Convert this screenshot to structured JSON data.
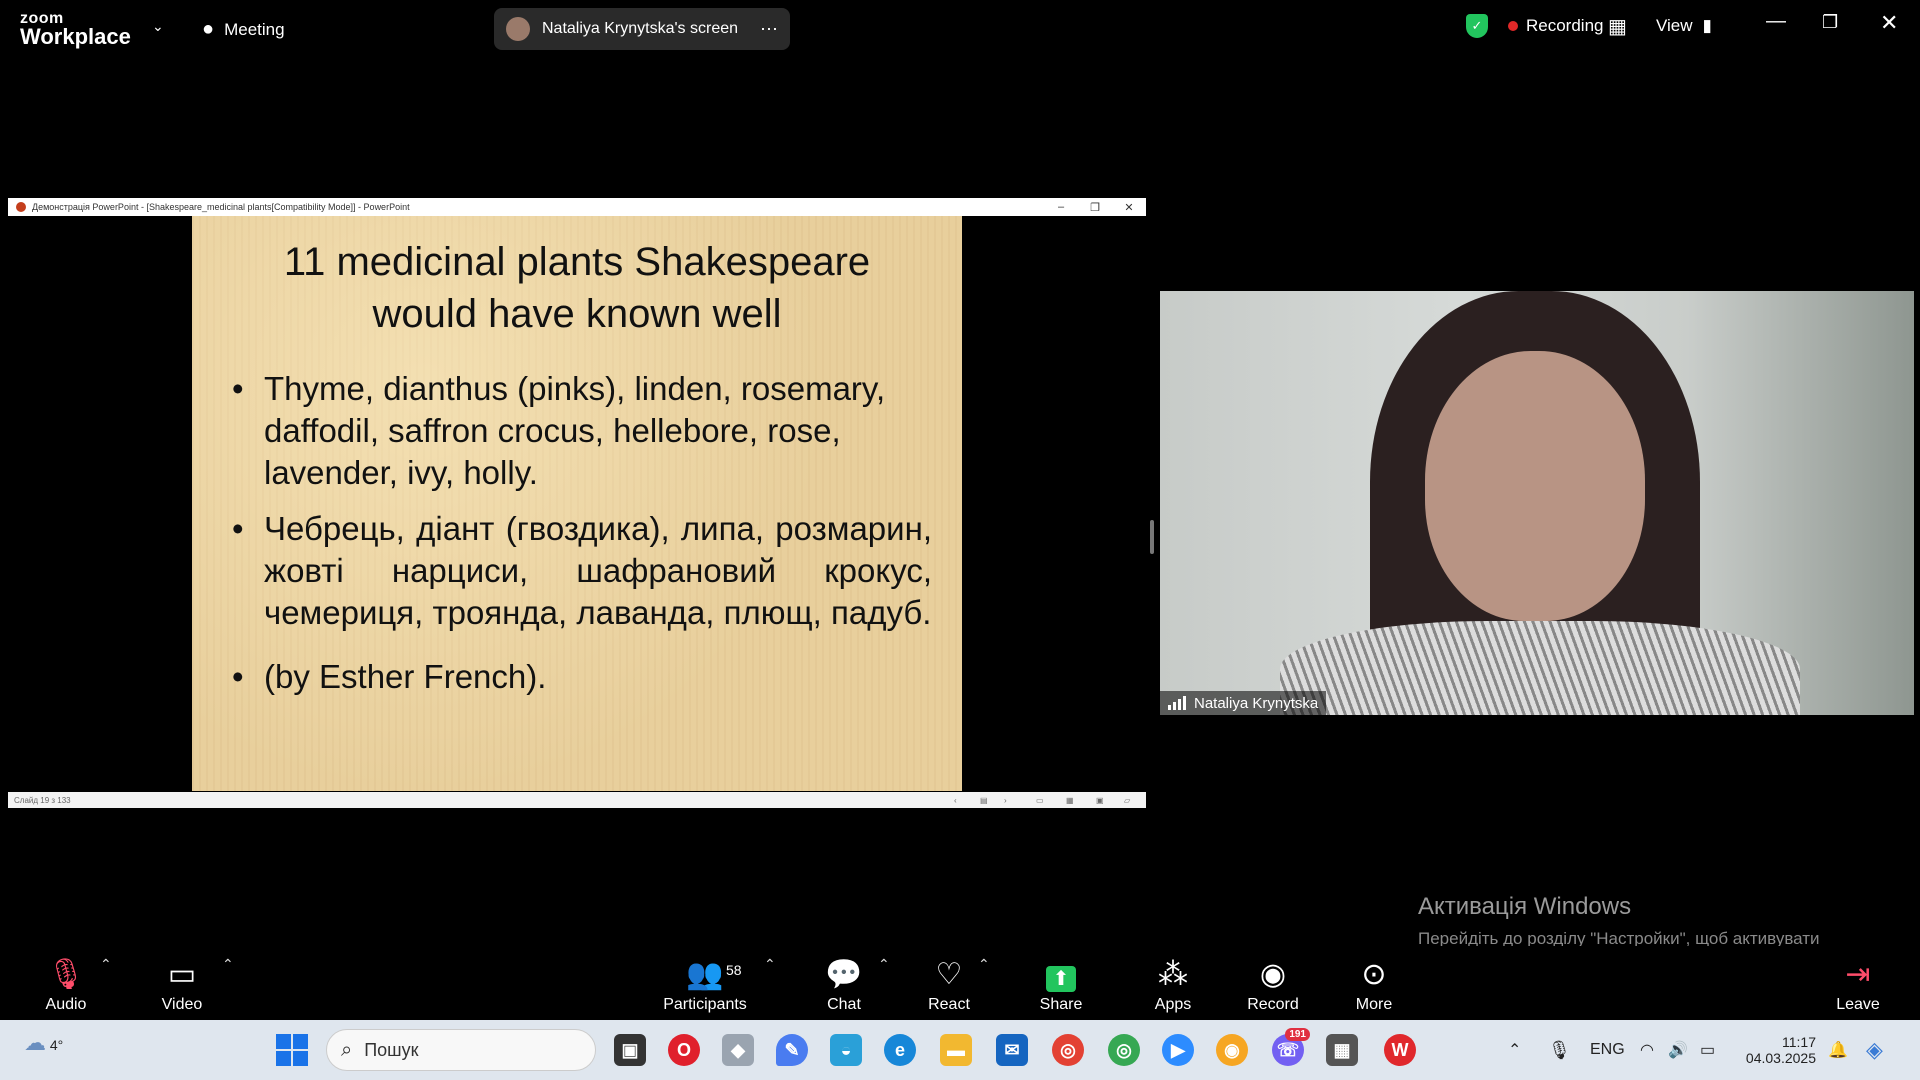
{
  "topbar": {
    "logo_small": "zoom",
    "logo_big": "Workplace",
    "meeting_label": "Meeting",
    "share_label": "Nataliya Krynytska's screen",
    "recording_label": "Recording",
    "view_label": "View",
    "colors": {
      "recording": "#e02828",
      "shield": "#22c55e"
    }
  },
  "ppt": {
    "window_title": "Демонстрація PowerPoint - [Shakespeare_medicinal plants[Compatibility Mode]] - PowerPoint",
    "status": "Слайд 19 з 133"
  },
  "slide": {
    "title_line1": "11 medicinal plants Shakespeare",
    "title_line2": "would have known well",
    "bullet_char": "•",
    "bullets": [
      "Thyme, dianthus (pinks), linden, rosemary, daffodil, saffron crocus, hellebore, rose, lavender, ivy, holly.",
      "Чебрець, діант (гвоздика), липа, розмарин, жовті нарциси, шафрановий крокус, чемериця, троянда, лаванда, плющ, падуб.",
      "(by Esther French)."
    ]
  },
  "video": {
    "participant_name": "Nataliya Krynytska"
  },
  "watermark": {
    "title": "Активація Windows",
    "line": "Перейдіть до розділу \"Настройки\", щоб активувати Windows."
  },
  "toolbar": {
    "audio": "Audio",
    "video": "Video",
    "participants": "Participants",
    "participants_count": "58",
    "chat": "Chat",
    "react": "React",
    "share": "Share",
    "apps": "Apps",
    "record": "Record",
    "more": "More",
    "leave": "Leave",
    "colors": {
      "share": "#22c55e",
      "leave": "#e02828"
    }
  },
  "taskbar": {
    "weather_temp": "4°",
    "search_placeholder": "Пошук",
    "viber_badge": "191",
    "language": "ENG",
    "time": "11:17",
    "date": "04.03.2025"
  }
}
